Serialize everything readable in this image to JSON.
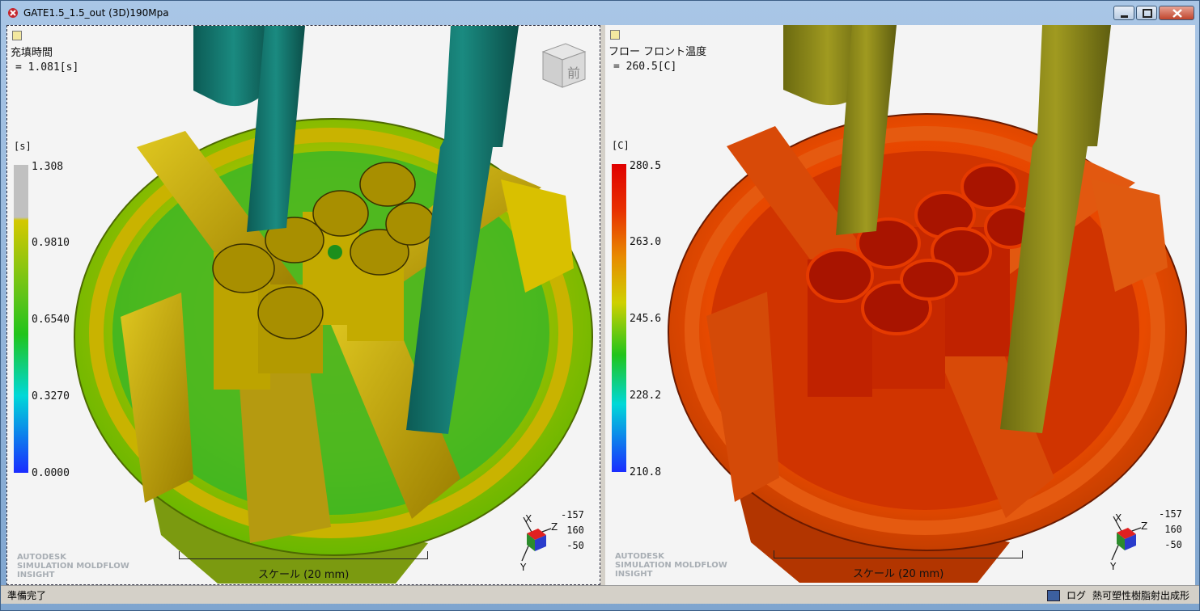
{
  "window": {
    "title": "GATE1.5_1.5_out (3D)190Mpa",
    "icon": "app-icon",
    "buttons": [
      "minimize",
      "maximize",
      "close"
    ]
  },
  "left_view": {
    "result_name": "充填時間",
    "result_value": "= 1.081[s]",
    "unit": "[s]",
    "legend_ticks": [
      "1.308",
      "0.9810",
      "0.6540",
      "0.3270",
      "0.0000"
    ],
    "scale_label": "スケール (20 mm)",
    "coords": [
      "-157",
      "160",
      "-50"
    ],
    "axis_labels": [
      "X",
      "Z",
      "Y"
    ],
    "logo_lines": [
      "AUTODESK",
      "SIMULATION MOLDFLOW",
      "INSIGHT"
    ],
    "viewcube_face": "前",
    "legend_colors": [
      "#c0c0c0",
      "#d4c800",
      "#21c41b",
      "#00d8d8",
      "#1a2cff"
    ]
  },
  "right_view": {
    "result_name": "フロー フロント温度",
    "result_value": "= 260.5[C]",
    "unit": "[C]",
    "legend_ticks": [
      "280.5",
      "263.0",
      "245.6",
      "228.2",
      "210.8"
    ],
    "scale_label": "スケール (20 mm)",
    "coords": [
      "-157",
      "160",
      "-50"
    ],
    "axis_labels": [
      "X",
      "Z",
      "Y"
    ],
    "logo_lines": [
      "AUTODESK",
      "SIMULATION MOLDFLOW",
      "INSIGHT"
    ],
    "legend_colors": [
      "#e00000",
      "#e87a00",
      "#cfd000",
      "#21c41b",
      "#00d8d8",
      "#1a2cff"
    ]
  },
  "statusbar": {
    "left": "準備完了",
    "log_label": "ログ",
    "right": "熱可塑性樹脂射出成形"
  }
}
